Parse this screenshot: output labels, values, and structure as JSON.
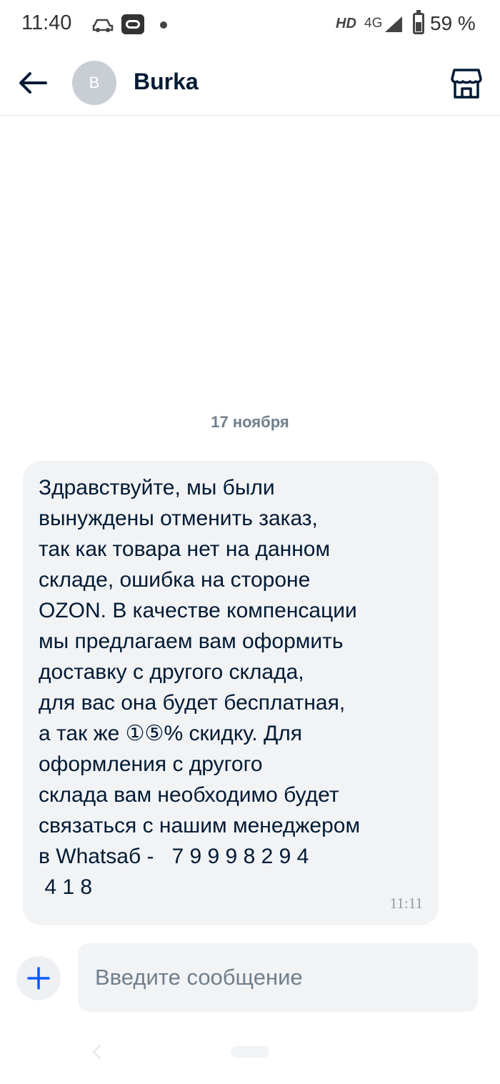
{
  "status_bar": {
    "time": "11:40",
    "hd": "HD",
    "network": "4G",
    "battery": "59 %"
  },
  "header": {
    "avatar_letter": "B",
    "title": "Burka"
  },
  "chat": {
    "date_separator": "17 ноября",
    "message": {
      "text": "Здравствуйте, мы были\nвынуждены отменить заказ,\nтак как товара нет на данном\nскладе, ошибка на стороне\nOZON. В качестве компенсации\nмы предлагаем вам оформить\nдоставку с другого склада,\nдля вас она будет бесплатная,\nа так же ①⑤% скидку. Для\nоформления с другого\nсклада вам необходимо будет\nсвязаться с нашим менеджером\nв Whatsaб -   7 9 9 9 8 2 9 4\n 4 1 8",
      "time": "11:11"
    }
  },
  "composer": {
    "placeholder": "Введите сообщение",
    "value": ""
  },
  "colors": {
    "accent": "#005bff",
    "bubble_bg": "#f2f3f5",
    "text": "#001a34",
    "muted": "#707f8d"
  },
  "icons": {
    "back": "arrow-left-icon",
    "store": "store-icon",
    "add": "plus-icon"
  }
}
